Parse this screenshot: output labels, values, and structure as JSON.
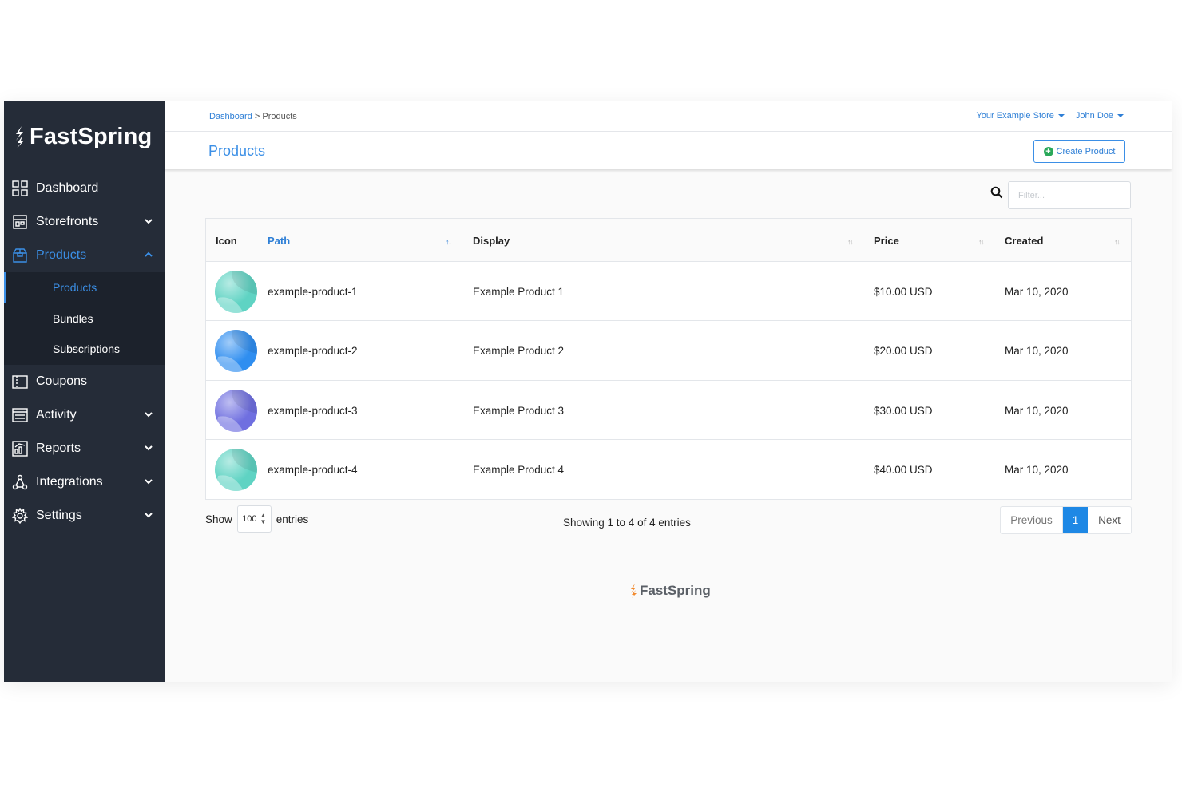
{
  "brand": {
    "name": "FastSpring"
  },
  "sidebar": {
    "items": [
      {
        "label": "Dashboard",
        "icon": "dashboard-icon"
      },
      {
        "label": "Storefronts",
        "icon": "storefront-icon"
      },
      {
        "label": "Products",
        "icon": "products-icon"
      },
      {
        "label": "Coupons",
        "icon": "coupon-icon"
      },
      {
        "label": "Activity",
        "icon": "activity-icon"
      },
      {
        "label": "Reports",
        "icon": "reports-icon"
      },
      {
        "label": "Integrations",
        "icon": "integrations-icon"
      },
      {
        "label": "Settings",
        "icon": "settings-icon"
      }
    ],
    "subitems": [
      {
        "label": "Products"
      },
      {
        "label": "Bundles"
      },
      {
        "label": "Subscriptions"
      }
    ]
  },
  "header": {
    "breadcrumb_link": "Dashboard",
    "breadcrumb_sep": " > ",
    "breadcrumb_current": "Products",
    "store": "Your Example Store",
    "user": "John Doe",
    "title": "Products",
    "create_label": "Create Product"
  },
  "filter": {
    "placeholder": "Filter..."
  },
  "table": {
    "columns": [
      "Icon",
      "Path",
      "Display",
      "Price",
      "Created"
    ],
    "rows": [
      {
        "path": "example-product-1",
        "display": "Example Product 1",
        "price": "$10.00 USD",
        "created": "Mar 10, 2020",
        "color": "#5fd3c3"
      },
      {
        "path": "example-product-2",
        "display": "Example Product 2",
        "price": "$20.00 USD",
        "created": "Mar 10, 2020",
        "color": "#2f8ef0"
      },
      {
        "path": "example-product-3",
        "display": "Example Product 3",
        "price": "$30.00 USD",
        "created": "Mar 10, 2020",
        "color": "#6f6fe0"
      },
      {
        "path": "example-product-4",
        "display": "Example Product 4",
        "price": "$40.00 USD",
        "created": "Mar 10, 2020",
        "color": "#5fd3c3"
      }
    ]
  },
  "pagination": {
    "show_label": "Show",
    "page_size": "100",
    "entries_label": "entries",
    "summary": "Showing 1 to 4 of 4 entries",
    "prev": "Previous",
    "current": "1",
    "next": "Next"
  },
  "colors": {
    "accent": "#3b8fe6",
    "sidebar_bg": "#252c38",
    "brand_orange": "#f28a2e"
  }
}
